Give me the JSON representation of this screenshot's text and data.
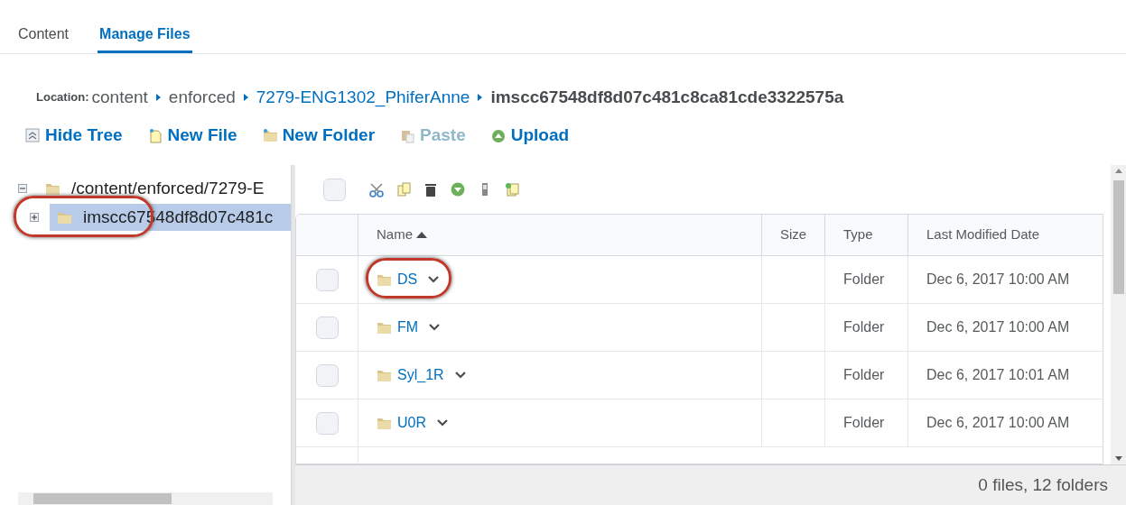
{
  "tabs": [
    {
      "label": "Content",
      "selected": false
    },
    {
      "label": "Manage Files",
      "selected": true
    }
  ],
  "location": {
    "label": "Location:",
    "path": [
      {
        "text": "content",
        "kind": "plain"
      },
      {
        "text": "enforced",
        "kind": "plain"
      },
      {
        "text": "7279-ENG1302_PhiferAnne",
        "kind": "link"
      },
      {
        "text": "imscc67548df8d07c481c8ca81cde3322575a",
        "kind": "current"
      }
    ]
  },
  "toolbar": [
    {
      "label": "Hide Tree",
      "kind": "hide",
      "disabled": false
    },
    {
      "label": "New File",
      "kind": "file",
      "disabled": false
    },
    {
      "label": "New Folder",
      "kind": "folder",
      "disabled": false
    },
    {
      "label": "Paste",
      "kind": "paste",
      "disabled": true
    },
    {
      "label": "Upload",
      "kind": "upload",
      "disabled": false
    }
  ],
  "tree": [
    {
      "label": "/content/enforced/7279-E",
      "expanded": true,
      "selected": false,
      "children": [
        {
          "label": "imscc67548df8d07c481c",
          "expanded": false,
          "selected": true,
          "annotated": true
        }
      ]
    }
  ],
  "file_actions": {
    "select_all": {
      "checked": false
    },
    "buttons": [
      {
        "kind": "cut"
      },
      {
        "kind": "copy"
      },
      {
        "kind": "delete"
      },
      {
        "kind": "more"
      },
      {
        "kind": "zip"
      },
      {
        "kind": "unzip"
      }
    ]
  },
  "table": {
    "columns": [
      {
        "label": "Name",
        "sorted": true
      },
      {
        "label": "Size",
        "sorted": false
      },
      {
        "label": "Type",
        "sorted": false
      },
      {
        "label": "Last Modified Date",
        "sorted": false
      }
    ],
    "rows": [
      {
        "name": "DS",
        "type": "Folder",
        "date": "Dec 6, 2017 10:00 AM",
        "checked": false,
        "annotated": true
      },
      {
        "name": "FM",
        "type": "Folder",
        "date": "Dec 6, 2017 10:00 AM",
        "checked": false,
        "annotated": false
      },
      {
        "name": "Syl_1R",
        "type": "Folder",
        "date": "Dec 6, 2017 10:01 AM",
        "checked": false,
        "annotated": false
      },
      {
        "name": "U0R",
        "type": "Folder",
        "date": "Dec 6, 2017 10:00 AM",
        "checked": false,
        "annotated": false
      }
    ]
  },
  "status_bar": "0 files, 12 folders"
}
